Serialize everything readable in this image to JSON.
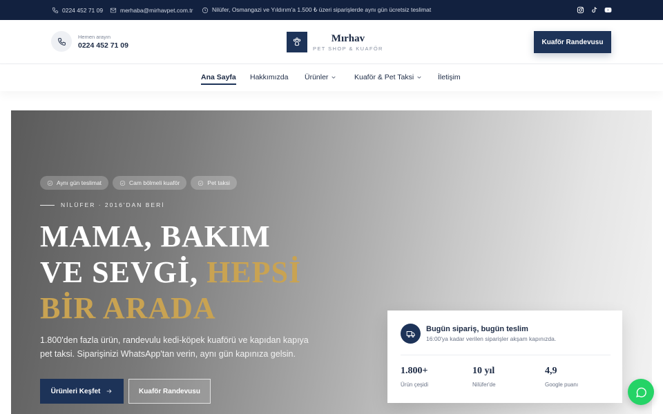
{
  "topbar": {
    "phone": "0224 452 71 09",
    "email": "merhaba@mirhavpet.com.tr",
    "notice": "Nilüfer, Osmangazi ve Yıldırım'a 1.500 ₺ üzeri siparişlerde aynı gün ücretsiz teslimat",
    "socials": [
      "instagram-icon",
      "tiktok-icon",
      "youtube-icon"
    ]
  },
  "header": {
    "call_label": "Hemen arayın",
    "call_number": "0224 452 71 09",
    "brand_name": "Mırhav",
    "brand_tagline": "PET SHOP & KUAFÖR",
    "cta_label": "Kuaför Randevusu"
  },
  "nav": {
    "items": [
      {
        "label": "Ana Sayfa",
        "active": true
      },
      {
        "label": "Hakkımızda"
      },
      {
        "label": "Ürünler",
        "dropdown": true
      },
      {
        "label": "Kuaför & Pet Taksi",
        "dropdown": true
      },
      {
        "label": "İletişim"
      }
    ]
  },
  "hero": {
    "chips": [
      "Aynı gün teslimat",
      "Cam bölmeli kuaför",
      "Pet taksi"
    ],
    "eyebrow": "NİLÜFER · 2016'DAN BERİ",
    "headline": {
      "line1": "MAMA, BAKIM",
      "line2_white": "VE SEVGİ, ",
      "line2_gold": "HEPSİ",
      "line3_gold": "BİR ARADA"
    },
    "description": "1.800'den fazla ürün, randevulu kedi-köpek kuaförü ve kapıdan kapıya pet taksi. Siparişinizi WhatsApp'tan verin, aynı gün kapınıza gelsin.",
    "primary_button": "Ürünleri Keşfet",
    "secondary_button": "Kuaför Randevusu"
  },
  "card": {
    "title": "Bugün sipariş, bugün teslim",
    "subtitle": "16:00'ya kadar verilen siparişler akşam kapınızda.",
    "stats": [
      {
        "value": "1.800+",
        "label": "Ürün çeşidi"
      },
      {
        "value": "10 yıl",
        "label": "Nilüfer'de"
      },
      {
        "value": "4,9",
        "label": "Google puanı"
      }
    ]
  },
  "colors": {
    "navy": "#1d3358",
    "topbar": "#12213f",
    "gold": "#c9a352",
    "whatsapp": "#25d366"
  }
}
